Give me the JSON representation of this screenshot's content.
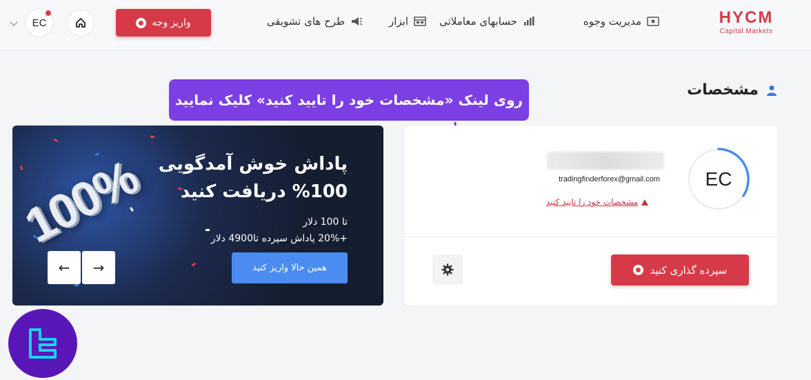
{
  "header": {
    "logo": {
      "mark": "HYCM",
      "sub": "Capital Markets"
    },
    "nav": [
      {
        "label": "مدیریت وجوه",
        "icon": "wallet-icon"
      },
      {
        "label": "حسابهای معاملاتی",
        "icon": "bar-chart-icon"
      },
      {
        "label": "ابزار",
        "icon": "calendar-icon"
      },
      {
        "label": "طرح های تشویقی",
        "icon": "megaphone-icon"
      }
    ],
    "deposit_label": "واریز وجه",
    "home_icon": "home-icon",
    "avatar_initials": "EC",
    "dropdown_icon": "chevron-down-icon"
  },
  "section": {
    "title": "مشخصات",
    "icon": "user-icon"
  },
  "callout": {
    "text": "روی لینک «مشخصات خود را تایید کنید» کلیک نمایید"
  },
  "profile": {
    "initials": "EC",
    "email": "tradingfinderforex@gmail.com",
    "verify_link": "مشخصات خود را تایید کنید",
    "deposit_label": "سپرده گذاری کنید",
    "settings_icon": "gear-icon"
  },
  "banner": {
    "title": "پاداش خوش آمدگویی 100% دریافت کنید",
    "line1": "تا 100 دلار",
    "line2": "+20% پاداش سپرده تا4900 دلار",
    "cta": "همین حالا واریز کنید",
    "big_text": "100%",
    "prev_icon": "arrow-left-icon",
    "next_icon": "arrow-right-icon"
  },
  "colors": {
    "brand": "#d63a48",
    "callout": "#7b3fe4",
    "cta": "#4a8cf0"
  }
}
